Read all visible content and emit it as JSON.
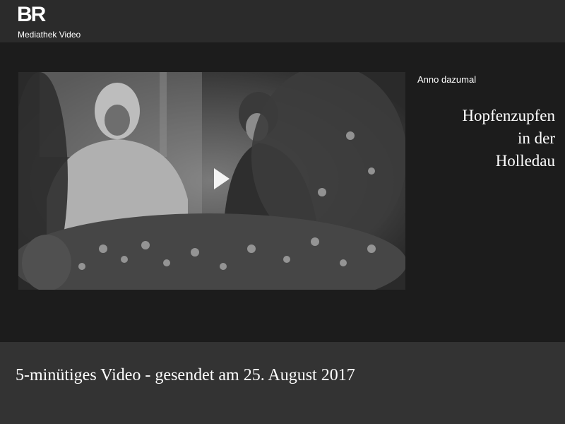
{
  "header": {
    "logo_mark": "BR",
    "logo_sub": "Mediathek Video"
  },
  "video": {
    "kicker": "Anno dazumal",
    "title_lines": [
      "Hopfenzupfen",
      "in der",
      "Holledau"
    ],
    "play_icon": "play-icon"
  },
  "footer": {
    "caption": "5-minütiges Video - gesendet am 25. August 2017"
  }
}
